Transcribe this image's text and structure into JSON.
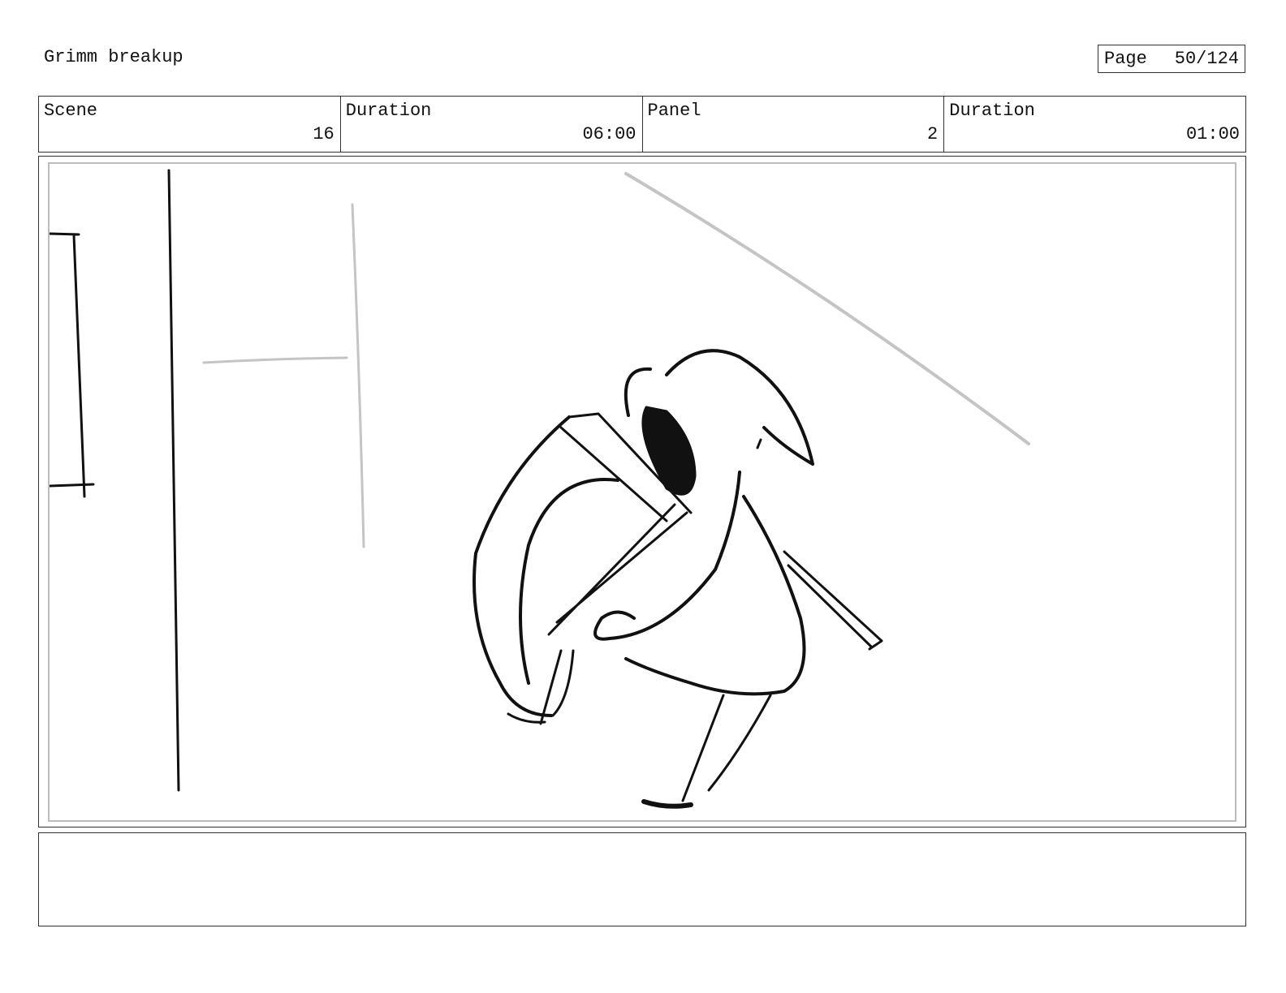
{
  "header": {
    "title": "Grimm breakup",
    "page_label": "Page",
    "page_value": "50/124"
  },
  "info": {
    "scene_label": "Scene",
    "scene_value": "16",
    "scene_duration_label": "Duration",
    "scene_duration_value": "06:00",
    "panel_label": "Panel",
    "panel_value": "2",
    "panel_duration_label": "Duration",
    "panel_duration_value": "01:00"
  },
  "notes": {
    "text": ""
  }
}
